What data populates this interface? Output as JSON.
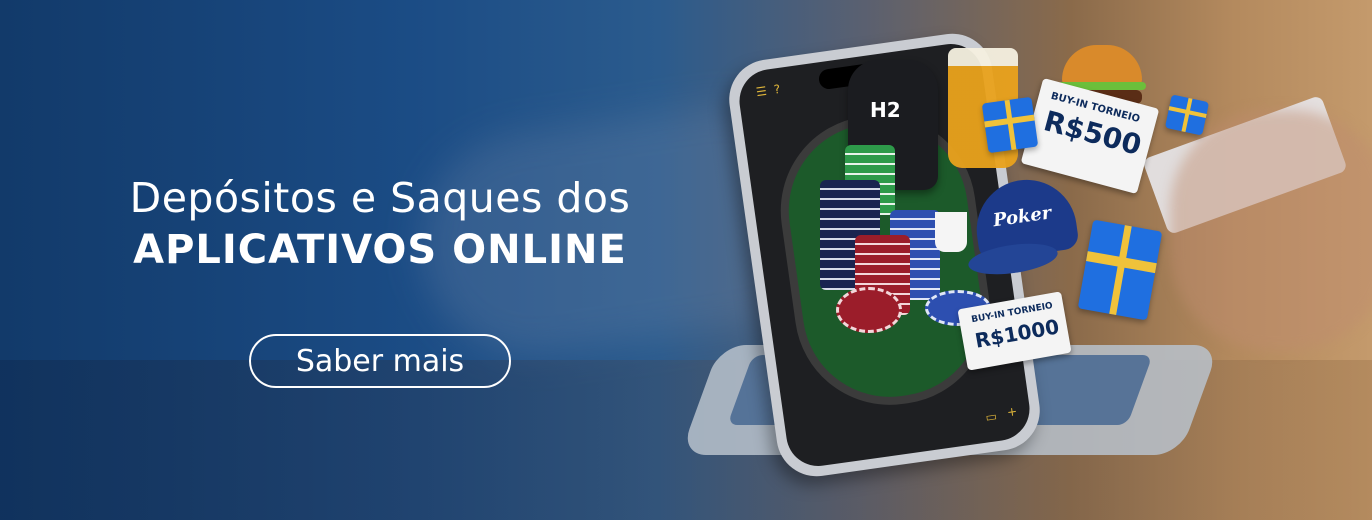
{
  "banner": {
    "headline_line1": "Depósitos e Saques dos",
    "headline_line2": "APLICATIVOS ONLINE",
    "cta_label": "Saber mais"
  },
  "illustration": {
    "hoodie_logo": "H2",
    "cap_text": "Poker",
    "ticket_1": {
      "label": "BUY-IN TORNEIO",
      "amount": "R$500"
    },
    "ticket_2": {
      "label": "BUY-IN TORNEIO",
      "amount": "R$1000"
    }
  },
  "colors": {
    "background_left": "#123a6a",
    "background_right": "#c49a6c",
    "text": "#ffffff",
    "table_felt": "#1c5a2a",
    "gift_blue": "#1f6fe0",
    "ribbon_gold": "#f0c23a"
  }
}
